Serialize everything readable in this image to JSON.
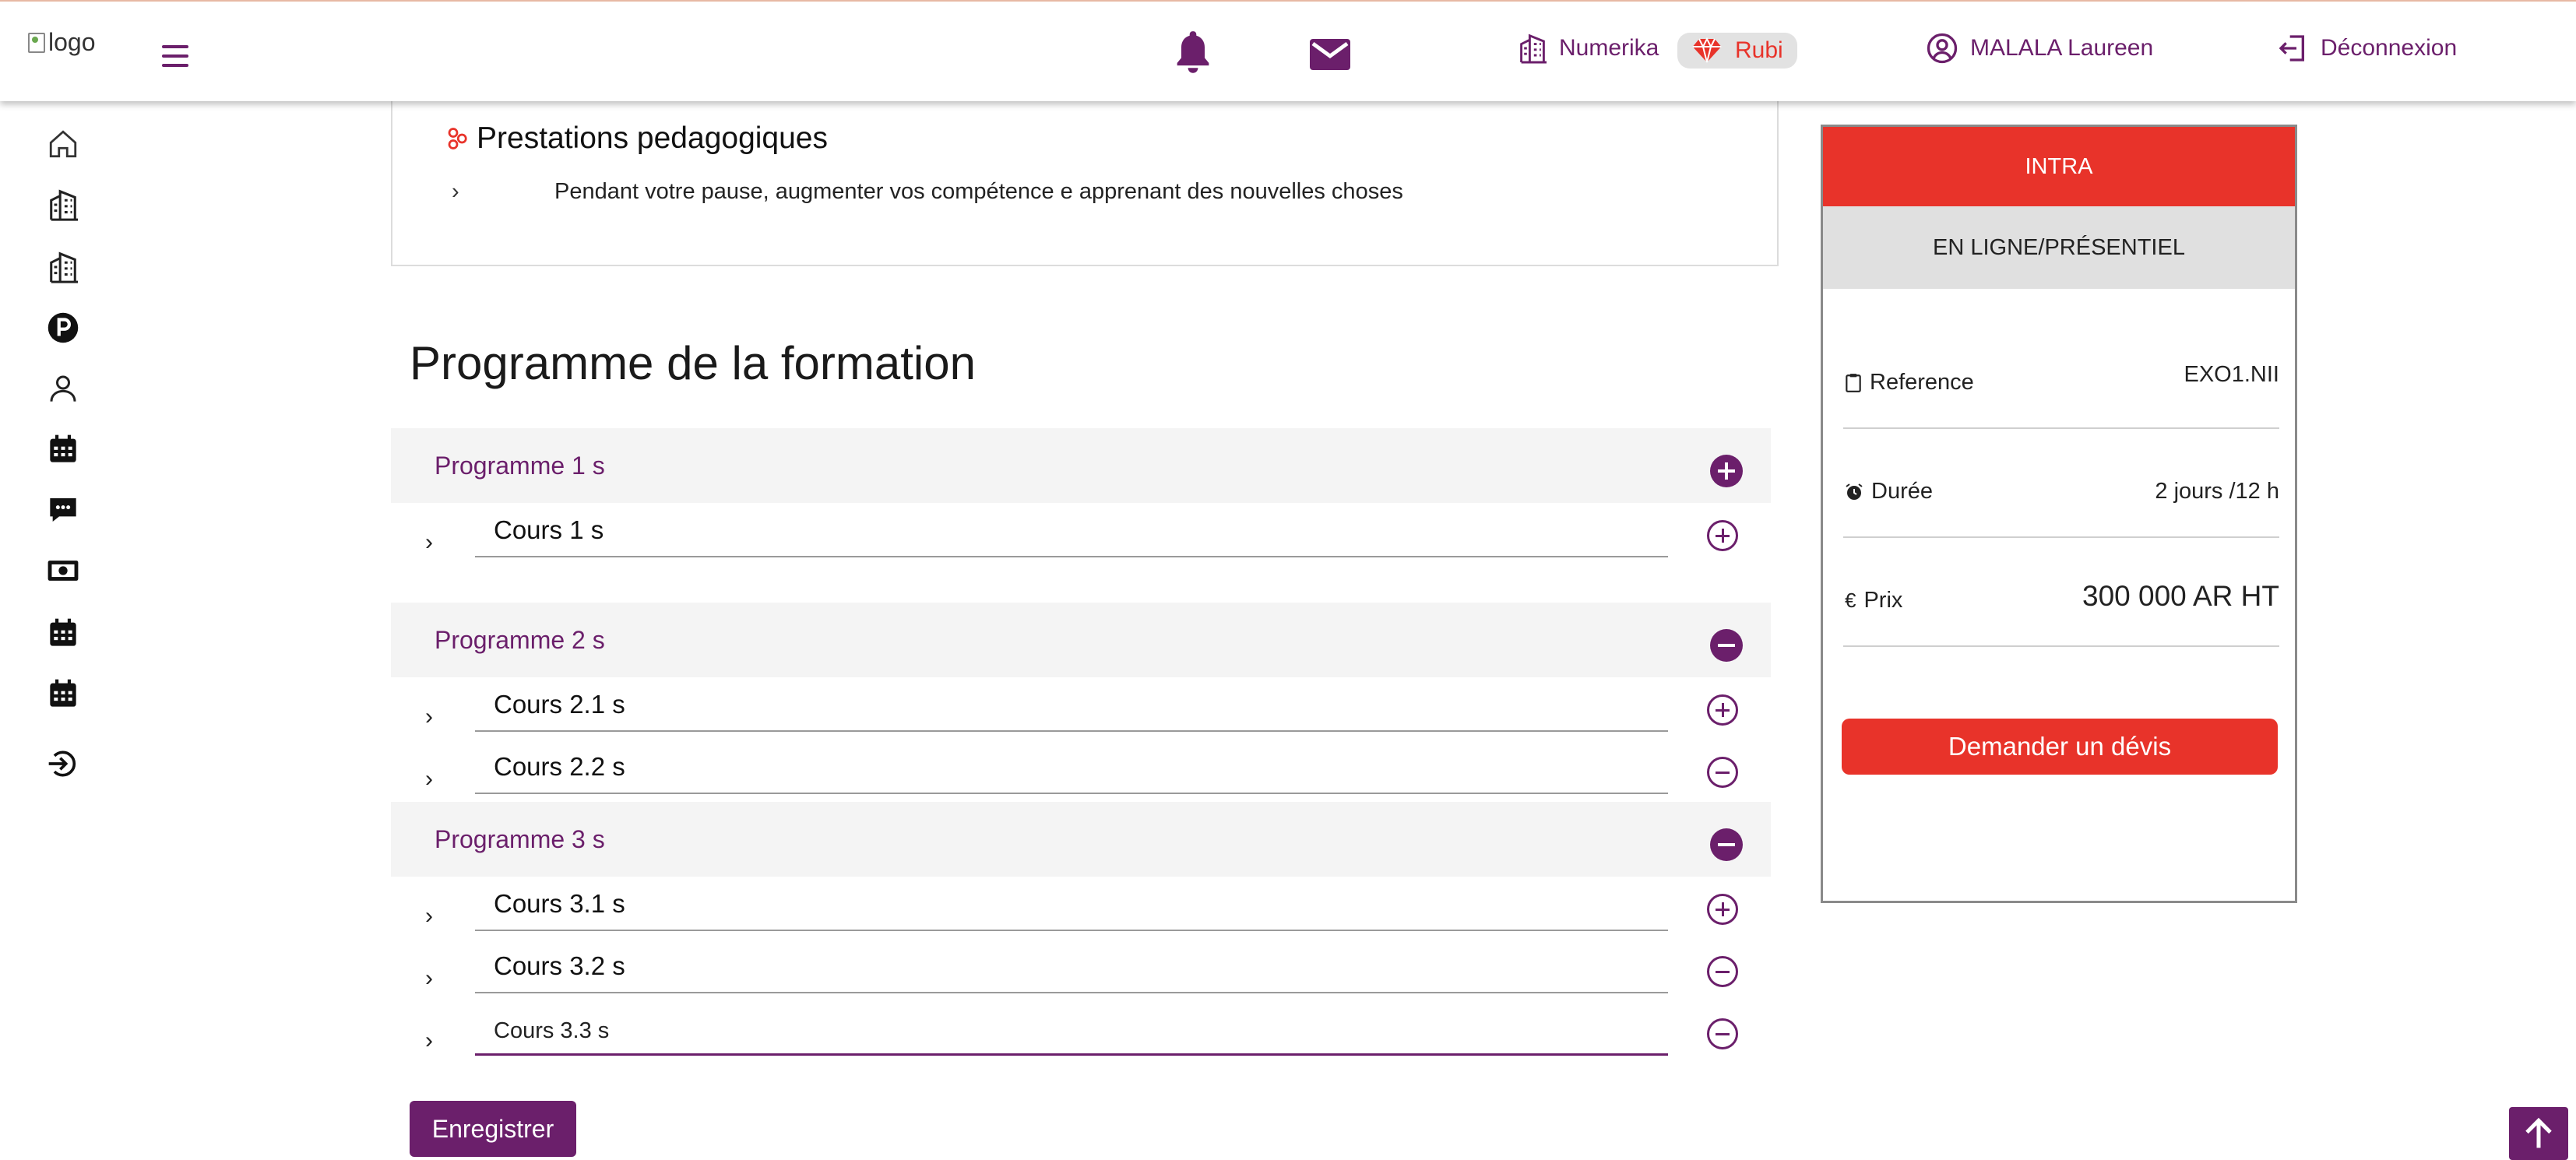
{
  "header": {
    "logo_alt": "logo",
    "nav_numerika": "Numerika",
    "nav_rubi": "Rubi",
    "user_name": "MALALA Laureen",
    "logout_label": "Déconnexion"
  },
  "prestations": {
    "title": "Prestations pedagogiques",
    "item": "Pendant votre pause, augmenter vos compétence e apprenant des nouvelles choses"
  },
  "programme": {
    "title": "Programme de la formation",
    "sections": [
      {
        "label": "Programme 1 s",
        "state": "collapsed",
        "cours": [
          "Cours 1 s"
        ]
      },
      {
        "label": "Programme 2 s",
        "state": "expanded",
        "cours": [
          "Cours 2.1 s",
          "Cours 2.2 s"
        ]
      },
      {
        "label": "Programme 3 s",
        "state": "expanded",
        "cours": [
          "Cours 3.1 s",
          "Cours 3.2 s",
          "Cours 3.3 s"
        ]
      }
    ],
    "save_label": "Enregistrer"
  },
  "offer": {
    "type": "INTRA",
    "mode": "EN LIGNE/PRÉSENTIEL",
    "reference_label": "Reference",
    "reference_value": "EXO1.NII",
    "duree_label": "Durée",
    "duree_value": "2 jours /12 h",
    "prix_label": "Prix",
    "prix_value": "300 000 AR HT",
    "currency_symbol": "€",
    "devis_label": "Demander un dévis"
  },
  "colors": {
    "primary": "#6b1f6b",
    "accent": "#e8332a",
    "header_bg": "#f4f4f4"
  },
  "icons": {
    "sidebar": [
      "home-icon",
      "building-icon",
      "building-icon",
      "parking-icon",
      "user-icon",
      "calendar-icon",
      "chat-icon",
      "money-icon",
      "calendar-icon",
      "calendar-icon",
      "logout-icon"
    ],
    "top": [
      "bell-icon",
      "mail-icon",
      "building-icon",
      "gem-icon",
      "user-circle-icon",
      "logout-icon"
    ]
  }
}
